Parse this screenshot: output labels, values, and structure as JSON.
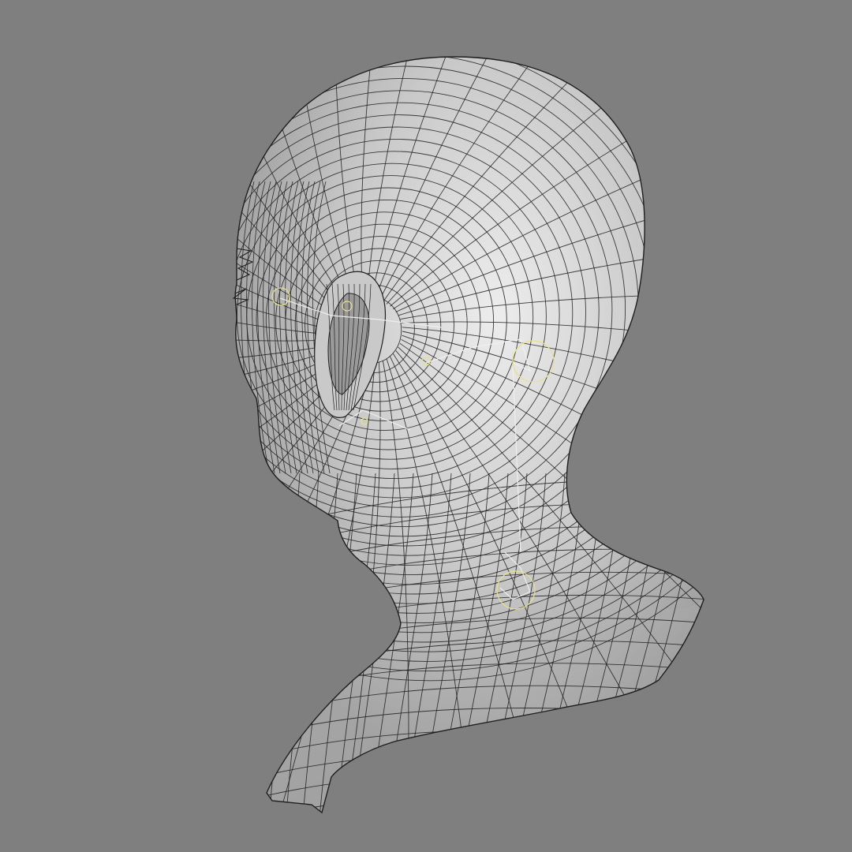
{
  "viewport": {
    "background_color": "#7f7f7f",
    "mesh_fill_color": "#c9c9c9",
    "mesh_highlight_color": "#ededed",
    "mesh_shadow_color": "#9a9a9a",
    "wire_color": "#1f1f1f",
    "joint_color": "#e6e08a",
    "bone_color": "#efefef"
  }
}
